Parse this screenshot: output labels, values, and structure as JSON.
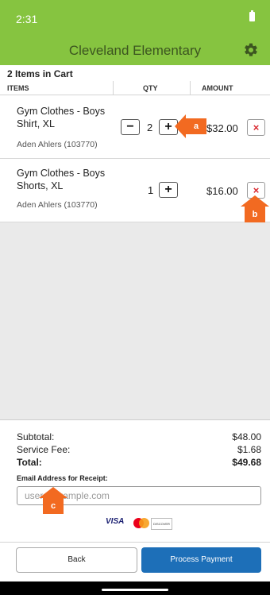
{
  "status": {
    "time": "2:31"
  },
  "header": {
    "title": "Cleveland Elementary"
  },
  "cart": {
    "count_label": "2 Items in Cart",
    "columns": {
      "items": "ITEMS",
      "qty": "QTY",
      "amount": "AMOUNT"
    },
    "rows": [
      {
        "name": "Gym Clothes - Boys Shirt, XL",
        "student": "Aden Ahlers (103770)",
        "qty": "2",
        "amount": "$32.00"
      },
      {
        "name": "Gym Clothes - Boys Shorts, XL",
        "student": "Aden Ahlers (103770)",
        "qty": "1",
        "amount": "$16.00"
      }
    ],
    "minus_glyph": "−",
    "plus_glyph": "+",
    "remove_glyph": "×"
  },
  "summary": {
    "subtotal_label": "Subtotal:",
    "subtotal": "$48.00",
    "fee_label": "Service Fee:",
    "fee": "$1.68",
    "total_label": "Total:",
    "total": "$49.68",
    "email_label": "Email Address for Receipt:",
    "email_placeholder": "user@example.com",
    "card_visa": "VISA",
    "card_discover": "DISCOVER"
  },
  "footer": {
    "back_label": "Back",
    "pay_label": "Process Payment"
  },
  "callouts": {
    "a": "a",
    "b": "b",
    "c": "c"
  },
  "icons": {
    "settings": "gear-icon",
    "remove": "close-icon",
    "battery": "battery-icon"
  },
  "colors": {
    "header_green": "#86c440",
    "primary_blue": "#1d6fb8",
    "callout_orange": "#f26a21",
    "remove_red": "#d9262c"
  }
}
